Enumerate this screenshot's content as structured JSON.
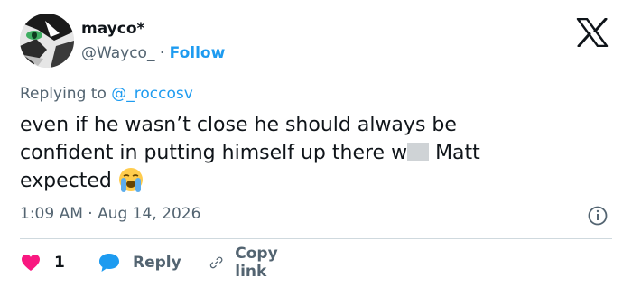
{
  "author": {
    "display_name": "mayco*",
    "handle": "@Wayco_",
    "separator": "·",
    "follow_label": "Follow"
  },
  "reply_context": {
    "prefix": "Replying to",
    "mention": "@_roccosv"
  },
  "tweet": {
    "line1": "even if he wasn’t close he should always be",
    "line2_a": "confident in putting himself up there w",
    "line2_b": "Matt",
    "line3": "expected"
  },
  "meta": {
    "timestamp": "1:09 AM · Aug 14, 2026"
  },
  "actions": {
    "like_count": "1",
    "reply_label": "Reply",
    "copy_label": "Copy link"
  },
  "colors": {
    "accent": "#1d9bf0",
    "like": "#f91880",
    "text": "#0f1419",
    "secondary": "#536471"
  },
  "icons": [
    "x-logo-icon",
    "info-icon",
    "heart-icon",
    "reply-bubble-icon",
    "link-icon",
    "crying-face-emoji"
  ]
}
